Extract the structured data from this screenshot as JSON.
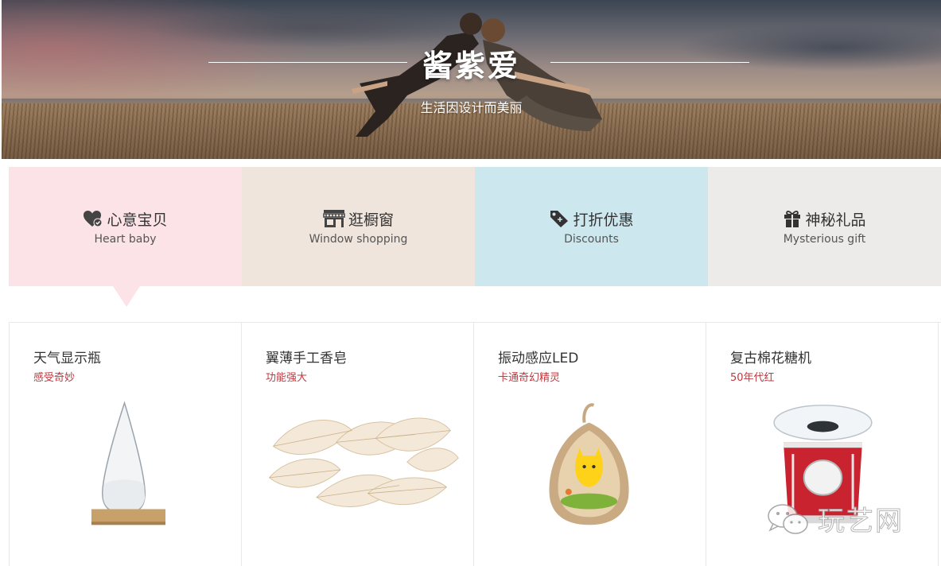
{
  "hero": {
    "title": "酱紫爱",
    "subtitle": "生活因设计而美丽"
  },
  "tabs": [
    {
      "cn": "心意宝贝",
      "en": "Heart baby",
      "icon": "heart-check-icon",
      "bg": "#fce3e8"
    },
    {
      "cn": "逛橱窗",
      "en": "Window shopping",
      "icon": "storefront-icon",
      "bg": "#efe5dc"
    },
    {
      "cn": "打折优惠",
      "en": "Discounts",
      "icon": "price-tag-icon",
      "bg": "#cde7ee"
    },
    {
      "cn": "神秘礼品",
      "en": "Mysterious gift",
      "icon": "gift-icon",
      "bg": "#ecebe9"
    }
  ],
  "products": [
    {
      "name": "天气显示瓶",
      "tag": "感受奇妙",
      "icon": "storm-glass-image"
    },
    {
      "name": "翼薄手工香皂",
      "tag": "功能强大",
      "icon": "leaf-soap-image"
    },
    {
      "name": "振动感应LED",
      "tag": "卡通奇幻精灵",
      "icon": "led-night-light-image"
    },
    {
      "name": "复古棉花糖机",
      "tag": "50年代红",
      "icon": "cotton-candy-machine-image"
    }
  ],
  "watermark": {
    "text": "玩艺网",
    "icon": "wechat-icon"
  },
  "colors": {
    "accent_red": "#c0393f",
    "pink": "#fce3e8"
  }
}
